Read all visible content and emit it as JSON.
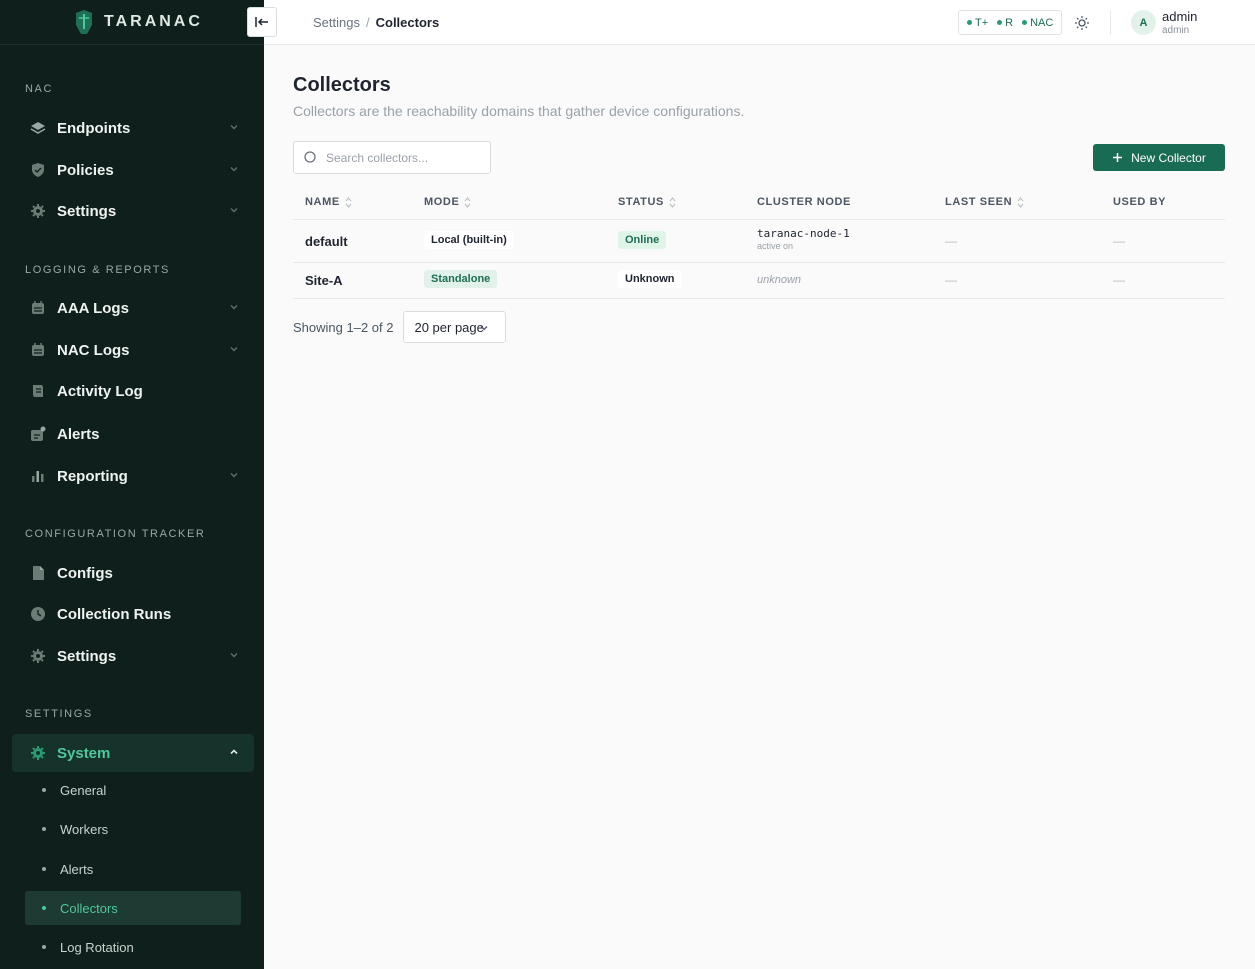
{
  "brand": {
    "name": "TARANAC"
  },
  "sidebar": {
    "sections": [
      {
        "label": "NAC"
      },
      {
        "label": "LOGGING & REPORTS"
      },
      {
        "label": "CONFIGURATION TRACKER"
      },
      {
        "label": "SETTINGS"
      }
    ],
    "items": [
      {
        "label": "Endpoints",
        "icon": "layers-icon"
      },
      {
        "label": "Policies",
        "icon": "shield-icon"
      },
      {
        "label": "Settings",
        "icon": "gear-icon"
      },
      {
        "label": "AAA Logs",
        "icon": "calendar-icon"
      },
      {
        "label": "NAC Logs",
        "icon": "calendar-icon"
      },
      {
        "label": "Activity Log",
        "icon": "scroll-icon"
      },
      {
        "label": "Alerts",
        "icon": "alert-icon"
      },
      {
        "label": "Reporting",
        "icon": "bar-chart-icon"
      },
      {
        "label": "Configs",
        "icon": "document-icon"
      },
      {
        "label": "Collection Runs",
        "icon": "clock-icon"
      },
      {
        "label": "Settings",
        "icon": "gear-icon"
      },
      {
        "label": "System",
        "icon": "gear-icon"
      }
    ],
    "sub_items": [
      {
        "label": "General"
      },
      {
        "label": "Workers"
      },
      {
        "label": "Alerts"
      },
      {
        "label": "Collectors"
      },
      {
        "label": "Log Rotation"
      }
    ]
  },
  "topbar": {
    "breadcrumb_parent": "Settings",
    "breadcrumb_sep": "/",
    "breadcrumb_current": "Collectors",
    "protocols": [
      "T+",
      "R",
      "NAC"
    ],
    "user_initial": "A",
    "user_name": "admin",
    "user_role": "admin"
  },
  "main": {
    "title": "Collectors",
    "subtitle": "Collectors are the reachability domains that gather device configurations.",
    "search_placeholder": "Search collectors...",
    "new_button": "New Collector",
    "columns": [
      "NAME",
      "MODE",
      "STATUS",
      "CLUSTER NODE",
      "LAST SEEN",
      "USED BY"
    ],
    "rows": [
      {
        "name": "default",
        "mode": "Local (built-in)",
        "status": "Online",
        "node": "taranac-node-1",
        "node_sub": "active on",
        "last_seen": "—",
        "used_by": "—"
      },
      {
        "name": "Site-A",
        "mode": "Standalone",
        "status": "Unknown",
        "node": "unknown",
        "node_sub": "",
        "last_seen": "—",
        "used_by": "—"
      }
    ],
    "showing": "Showing 1–2 of 2",
    "per_page": "20 per page"
  },
  "colors": {
    "sidebar_bg": "#0f1f1b",
    "accent": "#1a6b53",
    "active_text": "#4fc79a"
  }
}
